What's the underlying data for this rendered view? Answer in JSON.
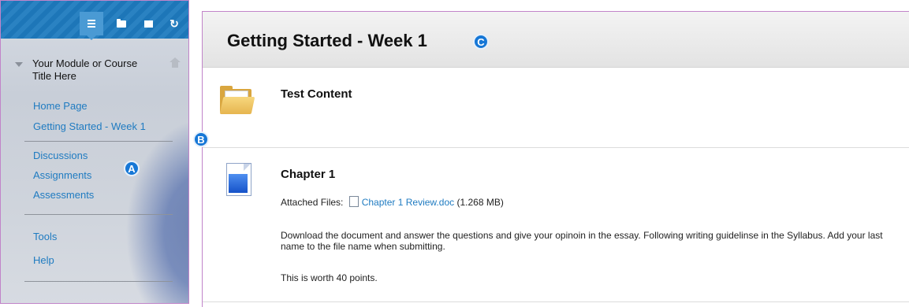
{
  "menu": {
    "toolbar": {
      "buttons": [
        {
          "name": "course-menu",
          "icon": "list-icon",
          "active": true
        },
        {
          "name": "folder-view",
          "icon": "folder-icon",
          "active": false
        },
        {
          "name": "new-window",
          "icon": "window-icon",
          "active": false
        },
        {
          "name": "refresh",
          "icon": "refresh-icon",
          "active": false
        }
      ]
    },
    "course_title": "Your Module or Course Title Here",
    "links_group1": [
      "Home Page",
      "Getting Started - Week 1"
    ],
    "links_group2": [
      "Discussions",
      "Assignments",
      "Assessments"
    ],
    "links_group3": [
      "Tools",
      "Help"
    ]
  },
  "markers": {
    "a": "A",
    "b": "B",
    "c": "C"
  },
  "content": {
    "page_title": "Getting Started - Week 1",
    "items": [
      {
        "title": "Test Content",
        "icon": "folder-icon"
      },
      {
        "title": "Chapter 1",
        "icon": "document-icon",
        "attached_label": "Attached Files:",
        "file_name": "Chapter 1 Review.doc",
        "file_size": "(1.268 MB)",
        "paragraph1": "Download the document and answer the questions and give your opinoin in the essay.  Following writing guidelinse in the Syllabus.  Add your last name to the file name when submitting.",
        "paragraph2": "This is worth 40 points."
      }
    ]
  },
  "colors": {
    "link": "#1f7bc1",
    "accent": "#1677d6",
    "toolbar": "#1d76b8"
  }
}
